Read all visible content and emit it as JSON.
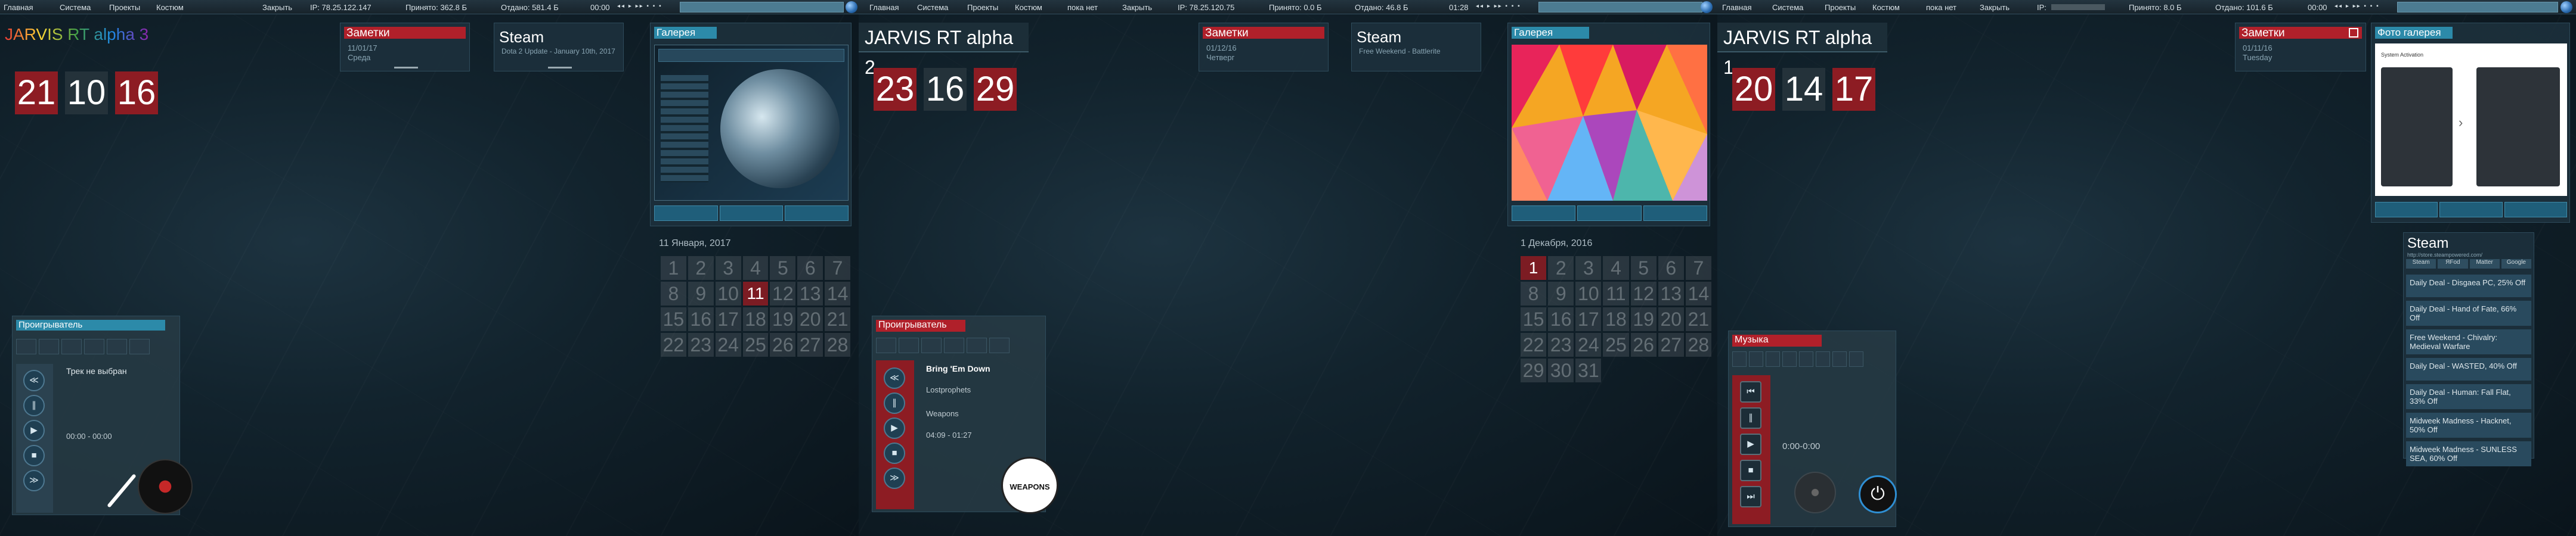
{
  "monitors": [
    {
      "topbar": {
        "menu": [
          "Главная",
          "Система",
          "Проекты",
          "Костюм",
          "Закрыть"
        ],
        "ip": "IP: 78.25.122.147",
        "recv": "Принято: 362.8 Б",
        "sent": "Отдано: 581.4 Б",
        "time": "00:00"
      },
      "clock_title": "JARVIS RT alpha 3",
      "clock": [
        "21",
        "10",
        "16"
      ],
      "notes": {
        "title": "Заметки",
        "date": "11/01/17",
        "day": "Среда"
      },
      "steam": {
        "title": "Steam",
        "news": "Dota 2 Update - January 10th, 2017"
      },
      "gallery": {
        "title": "Галерея"
      },
      "calendar": {
        "month": "11 Января, 2017",
        "days": [
          "1",
          "2",
          "3",
          "4",
          "5",
          "6",
          "7",
          "8",
          "9",
          "10",
          "11",
          "12",
          "13",
          "14",
          "15",
          "16",
          "17",
          "18",
          "19",
          "20",
          "21",
          "22",
          "23",
          "24",
          "25",
          "26",
          "27",
          "28"
        ],
        "today": "11"
      },
      "player": {
        "title": "Проигрыватель",
        "track": "Трек не выбран",
        "time": "00:00 - 00:00"
      }
    },
    {
      "topbar": {
        "menu": [
          "Главная",
          "Система",
          "Проекты",
          "Костюм",
          "пока нет",
          "Закрыть"
        ],
        "ip": "IP: 78.25.120.75",
        "recv": "Принято: 0.0 Б",
        "sent": "Отдано: 46.8 Б",
        "time": "01:28"
      },
      "jarvis": "JARVIS RT alpha 2",
      "clock": [
        "23",
        "16",
        "29"
      ],
      "notes": {
        "title": "Заметки",
        "date": "01/12/16",
        "day": "Четверг"
      },
      "steam": {
        "title": "Steam",
        "news": "Free Weekend - Battlerite"
      },
      "gallery": {
        "title": "Галерея"
      },
      "calendar": {
        "month": "1 Декабря, 2016",
        "days": [
          "1",
          "2",
          "3",
          "4",
          "5",
          "6",
          "7",
          "8",
          "9",
          "10",
          "11",
          "12",
          "13",
          "14",
          "15",
          "16",
          "17",
          "18",
          "19",
          "20",
          "21",
          "22",
          "23",
          "24",
          "25",
          "26",
          "27",
          "28",
          "29",
          "30",
          "31"
        ],
        "today": "1"
      },
      "player": {
        "title": "Проигрыватель",
        "track": "Bring 'Em Down",
        "artist": "Lostprophets",
        "album": "Weapons",
        "time": "04:09 - 01:27",
        "logo": "WEAPONS"
      }
    },
    {
      "topbar": {
        "menu": [
          "Главная",
          "Система",
          "Проекты",
          "Костюм",
          "пока нет",
          "Закрыть"
        ],
        "ip": "IP: ",
        "recv": "Принято: 8.0 Б",
        "sent": "Отдано: 101.6 Б",
        "time": "00:00"
      },
      "jarvis": "JARVIS RT alpha 1",
      "clock": [
        "20",
        "14",
        "17"
      ],
      "music": {
        "title": "Музыка",
        "time": "0:00-0:00"
      },
      "notes": {
        "title": "Заметки",
        "date": "01/11/16",
        "day": "Tuesday"
      },
      "photos": {
        "title": "Фото галерея",
        "caption": "System Activation"
      },
      "steam": {
        "title": "Steam",
        "url": "http://store.steampowered.com/",
        "cols": [
          "Steam",
          "ЯFod",
          "Matter",
          "Google"
        ],
        "items": [
          "Daily Deal - Disgaea PC, 25% Off",
          "Daily Deal - Hand of Fate, 66% Off",
          "Free Weekend - Chivalry: Medieval Warfare",
          "Daily Deal - WASTED, 40% Off",
          "Daily Deal - Human: Fall Flat, 33% Off",
          "Midweek Madness - Hacknet, 50% Off",
          "Midweek Madness - SUNLESS SEA, 60% Off"
        ]
      }
    }
  ],
  "colors": {
    "accent_red": "#b0202a",
    "accent_blue": "#2c8aa9"
  }
}
